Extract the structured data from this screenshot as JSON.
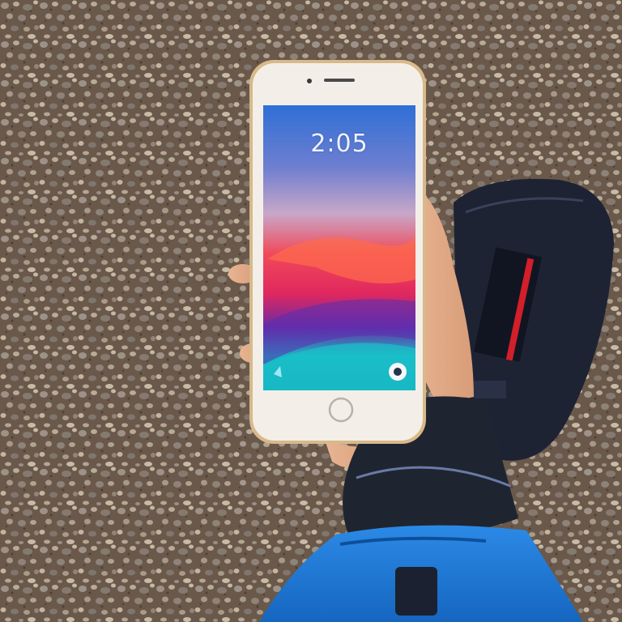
{
  "photo": {
    "description_free": true
  },
  "phone": {
    "lock_screen": {
      "time": "2:05",
      "date_line": ""
    }
  },
  "colors": {
    "ground": "#6b5a4c",
    "phone_body": "#f3efe8",
    "phone_trim": "#d8b98a",
    "jacket_blue": "#1e7fd8",
    "pouch": "#1d2333",
    "pouch_stripe": "#d21f2a"
  }
}
